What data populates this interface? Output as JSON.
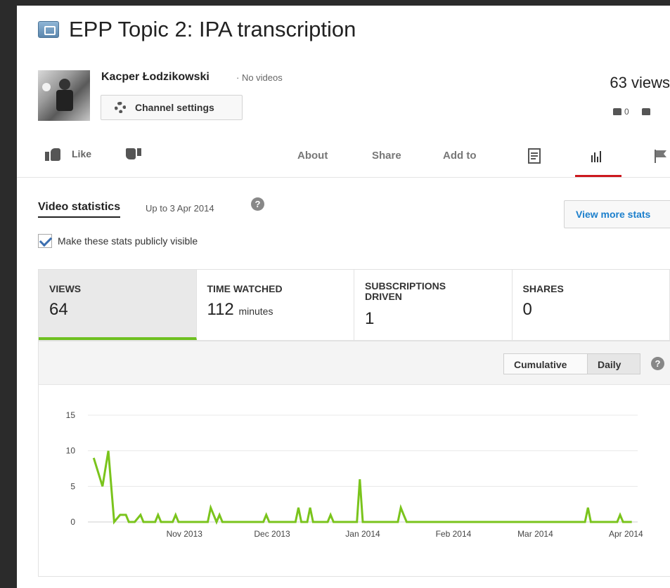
{
  "video": {
    "title": "EPP Topic 2: IPA transcription",
    "owner_name": "Kacper Łodzikowski",
    "owner_meta": "· No videos",
    "channel_settings_label": "Channel settings",
    "views_summary": "63 views",
    "likes": "0"
  },
  "actions": {
    "like_label": "Like",
    "about": "About",
    "share": "Share",
    "add_to": "Add to"
  },
  "stats": {
    "heading": "Video statistics",
    "up_to": "Up to 3 Apr 2014",
    "help": "?",
    "view_more": "View more stats",
    "public_label": "Make these stats publicly visible",
    "public_checked": true
  },
  "metrics": [
    {
      "label": "VIEWS",
      "value": "64",
      "unit": ""
    },
    {
      "label": "TIME WATCHED",
      "value": "112",
      "unit": "minutes"
    },
    {
      "label": "SUBSCRIPTIONS DRIVEN",
      "value": "1",
      "unit": ""
    },
    {
      "label": "SHARES",
      "value": "0",
      "unit": ""
    }
  ],
  "toggles": {
    "cumulative": "Cumulative",
    "daily": "Daily",
    "selected": "Daily"
  },
  "colors": {
    "line": "#7ac41c",
    "active_tab_border": "#6ec021",
    "stats_tab_underline": "#cc181e",
    "link": "#1b7fcc"
  },
  "chart_data": {
    "type": "line",
    "title": "",
    "xlabel": "",
    "ylabel": "",
    "ylim": [
      0,
      15
    ],
    "yticks": [
      0,
      5,
      10,
      15
    ],
    "xticks": [
      "Nov 2013",
      "Dec 2013",
      "Jan 2014",
      "Feb 2014",
      "Mar 2014",
      "Apr 2014"
    ],
    "grid": true,
    "series": [
      {
        "x": [
          "2013-10-01",
          "2013-10-04",
          "2013-10-06",
          "2013-10-08",
          "2013-10-10",
          "2013-10-12",
          "2013-10-13",
          "2013-10-15",
          "2013-10-17",
          "2013-10-18",
          "2013-10-19",
          "2013-10-22",
          "2013-10-23",
          "2013-10-24",
          "2013-10-28",
          "2013-10-29",
          "2013-10-30",
          "2013-11-09",
          "2013-11-10",
          "2013-11-11",
          "2013-11-12",
          "2013-11-13",
          "2013-11-14",
          "2013-11-15",
          "2013-11-16",
          "2013-11-17",
          "2013-11-28",
          "2013-11-29",
          "2013-11-30",
          "2013-12-09",
          "2013-12-10",
          "2013-12-11",
          "2013-12-13",
          "2013-12-14",
          "2013-12-15",
          "2013-12-20",
          "2013-12-21",
          "2013-12-22",
          "2013-12-30",
          "2013-12-31",
          "2014-01-01",
          "2014-01-13",
          "2014-01-14",
          "2014-01-15",
          "2014-01-16",
          "2014-03-18",
          "2014-03-19",
          "2014-03-20",
          "2014-03-29",
          "2014-03-30",
          "2014-03-31",
          "2014-04-03"
        ],
        "values": [
          9,
          5,
          10,
          0,
          1,
          1,
          0,
          0,
          1,
          0,
          0,
          0,
          1,
          0,
          0,
          1,
          0,
          0,
          2,
          1,
          0,
          1,
          0,
          0,
          0,
          0,
          0,
          1,
          0,
          0,
          2,
          0,
          0,
          2,
          0,
          0,
          1,
          0,
          0,
          6,
          0,
          0,
          2,
          1,
          0,
          0,
          2,
          0,
          0,
          1,
          0,
          0
        ]
      }
    ]
  }
}
